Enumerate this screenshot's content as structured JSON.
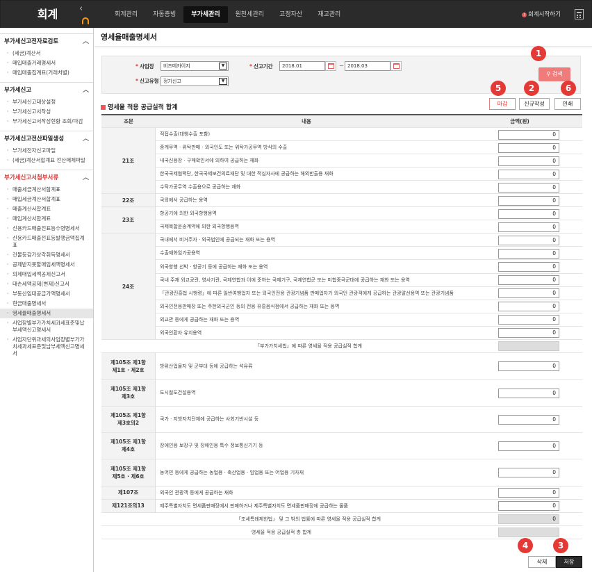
{
  "app": {
    "brand": "회계",
    "nav": [
      "회계관리",
      "자동증빙",
      "부가세관리",
      "원천세관리",
      "고정자산",
      "재고관리"
    ],
    "active_nav": 2,
    "start_label": "회계시작하기",
    "start_dot": "!"
  },
  "sidebar": {
    "sections": [
      {
        "title": "부가세신고전자료검토",
        "red": false,
        "items": [
          "(세금)계산서",
          "매입매출거래명세서",
          "매입매출집계표(거래처별)"
        ]
      },
      {
        "title": "부가세신고",
        "red": false,
        "items": [
          "부가세신고대상설정",
          "부가세신고서작성",
          "부가세신고서작성현황 조회/마감"
        ]
      },
      {
        "title": "부가세신고전산파일생성",
        "red": false,
        "items": [
          "부가세전자신고파일",
          "(세금)계산서합계표 전산매체파일"
        ]
      },
      {
        "title": "부가세신고서첨부서류",
        "red": true,
        "items": [
          "매출세금계산서합계표",
          "매입세금계산서합계표",
          "매출계산서합계표",
          "매입계산서합계표",
          "신용카드매출전표등수령명세서",
          "신용카드매출전표등발행금액집계표",
          "건물등감가상각취득명세서",
          "공제받지못할매입세액명세서",
          "의제매입세액공제신고서",
          "대손세액공제(변제)신고서",
          "부동산임대공급가액명세서",
          "현금매출명세서",
          "영세율매출명세서",
          "사업장별부가가치세과세표준및납부세액신고명세서",
          "사업자단위과세의사업장별부가가치세과세표준및납부세액신고명세서"
        ]
      }
    ],
    "selected_item": "영세율매출명세서"
  },
  "page": {
    "title": "영세율매출명세서"
  },
  "filter": {
    "business_label": "사업장",
    "business_value": "비즈메카이지",
    "period_label": "신고기간",
    "period_from": "2018.01",
    "period_sep": "~",
    "period_to": "2018.03",
    "type_label": "신고유형",
    "type_value": "정기신고",
    "search_label": "검색"
  },
  "actions": {
    "close": "마감",
    "new": "신규작성",
    "print": "인쇄",
    "delete": "삭제",
    "save": "저장"
  },
  "callouts": {
    "search": "1",
    "new": "2",
    "save": "3",
    "delete": "4",
    "close": "5",
    "print": "6"
  },
  "section_title": "영세율 적용 공급실적 합계",
  "table": {
    "headers": [
      "조문",
      "내용",
      "금액(원)"
    ],
    "groups": [
      {
        "article": "21조",
        "rows": [
          {
            "desc": "직접수출(대행수출 포함)",
            "amount": "0"
          },
          {
            "desc": "중계무역 · 위탁판매 · 외국인도 또는 위탁가공무역 방식의 수출",
            "amount": "0"
          },
          {
            "desc": "내국신용장 · 구매확인서에 의하여 공급하는 재화",
            "amount": "0"
          },
          {
            "desc": "한국국제협력단, 한국국제보건의료재단 및 대한 적십자사에 공급하는 해외반출용 재화",
            "amount": "0"
          },
          {
            "desc": "수탁가공무역 수출용으로 공급하는 재화",
            "amount": "0"
          }
        ]
      },
      {
        "article": "22조",
        "rows": [
          {
            "desc": "국외에서 공급하는 용역",
            "amount": "0"
          }
        ]
      },
      {
        "article": "23조",
        "rows": [
          {
            "desc": "항공기에 의한 외국항행용역",
            "amount": "0"
          },
          {
            "desc": "국제복합운송계약에 의한 외국항행용역",
            "amount": "0"
          }
        ]
      },
      {
        "article": "24조",
        "rows": [
          {
            "desc": "국내에서 비거주자 · 외국법인에 공급되는 재화 또는 용역",
            "amount": "0"
          },
          {
            "desc": "수출재화임가공용역",
            "amount": "0"
          },
          {
            "desc": "외국항행 선박 · 항공기 등에 공급하는 재화 또는 용역",
            "amount": "0"
          },
          {
            "desc": "국내 주재 외교공관, 영사기관, 국제연합과 이에 준하는 국제기구, 국제연합군 또는 미합중국군대에 공급하는 재화 또는 용역",
            "amount": "0"
          },
          {
            "desc": "「관광진흥법 시행령」에 따른 일반여행업자 또는 외국인전용 관광기념품 판매업자가 외국인 관광객에게 공급하는 관광알선용역 또는 관광기념품",
            "amount": "0"
          },
          {
            "desc": "외국인전용판매장 또는 주한외국군인 등의 전용 유흥음식점에서 공급하는 재화 또는 용역",
            "amount": "0"
          },
          {
            "desc": "외교관 등에게 공급하는 재화 또는 용역",
            "amount": "0"
          },
          {
            "desc": "외국인환자 유치용역",
            "amount": "0"
          }
        ]
      }
    ],
    "subtotal_vat": {
      "label": "「부가가치세법」에 따른 영세율 적용 공급실적 합계",
      "amount": ""
    },
    "special": [
      {
        "article": [
          "제105조 제1항",
          "제1호 · 제2호"
        ],
        "desc": "방위산업물자 및 군부대 등에 공급하는 석유류",
        "amount": "0"
      },
      {
        "article": [
          "제105조 제1항",
          "제3호"
        ],
        "desc": "도시철도건설용역",
        "amount": "0"
      },
      {
        "article": [
          "제105조 제1항",
          "제3호의2"
        ],
        "desc": "국가 · 지방자치단체에 공급하는 사회기반시설 등",
        "amount": "0"
      },
      {
        "article": [
          "제105조 제1항",
          "제4호"
        ],
        "desc": "장애인용 보장구 및 장애인용 특수 정보통신기기 등",
        "amount": "0"
      },
      {
        "article": [
          "제105조 제1항",
          "제5호 · 제6호"
        ],
        "desc": "농어민 등에게 공급하는 농업용 · 축산업용 · 임업용 또는 어업용 기자재",
        "amount": "0"
      },
      {
        "article": [
          "제107조"
        ],
        "desc": "외국인 관광객 등에게 공급하는 재화",
        "amount": "0"
      },
      {
        "article": [
          "제121조의13"
        ],
        "desc": "제주특별자치도 면세품판매장에서 판매하거나 제주특별자치도 면세품판매장에 공급하는 물품",
        "amount": "0"
      }
    ],
    "subtotal_special": {
      "label": "「조세특례제한법」 및 그 밖의 법률에 따른 영세율 적용 공급실적 합계",
      "amount": "0"
    },
    "total": {
      "label": "영세율 적용 공급실적 총 합계",
      "amount": ""
    }
  }
}
